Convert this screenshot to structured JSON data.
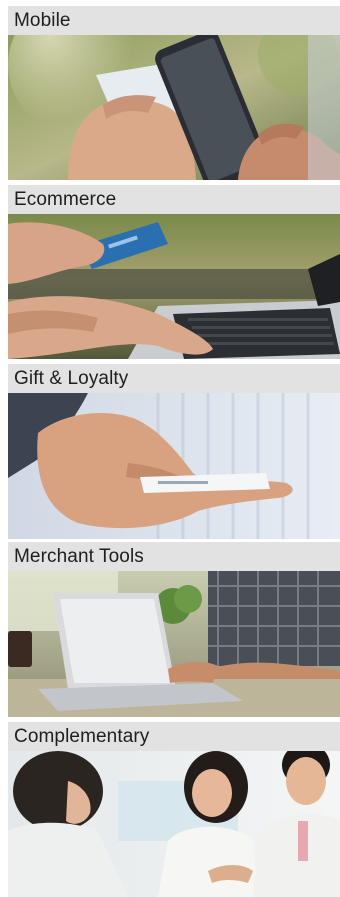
{
  "sections": [
    {
      "label": "Mobile"
    },
    {
      "label": "Ecommerce"
    },
    {
      "label": "Gift & Loyalty"
    },
    {
      "label": "Merchant Tools"
    },
    {
      "label": "Complementary"
    }
  ]
}
